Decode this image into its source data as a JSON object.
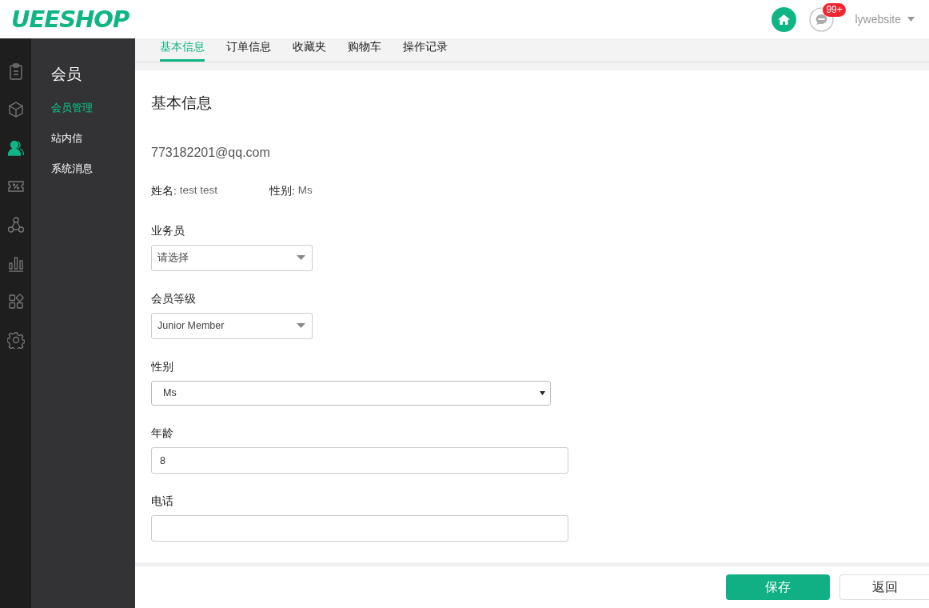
{
  "header": {
    "logo": "UEESHOP",
    "badge": "99+",
    "user": "lywebsite"
  },
  "rail": [
    {
      "kind": "clipboard",
      "selected": false
    },
    {
      "kind": "box",
      "selected": false
    },
    {
      "kind": "user",
      "selected": true
    },
    {
      "kind": "coupon",
      "selected": false
    },
    {
      "kind": "network",
      "selected": false
    },
    {
      "kind": "chart",
      "selected": false
    },
    {
      "kind": "apps",
      "selected": false
    },
    {
      "kind": "gear",
      "selected": false
    }
  ],
  "submenu": {
    "title": "会员",
    "items": [
      {
        "label": "会员管理",
        "selected": true
      },
      {
        "label": "站内信",
        "selected": false
      },
      {
        "label": "系统消息",
        "selected": false
      }
    ]
  },
  "tabs": [
    {
      "label": "基本信息",
      "selected": true
    },
    {
      "label": "订单信息",
      "selected": false
    },
    {
      "label": "收藏夹",
      "selected": false
    },
    {
      "label": "购物车",
      "selected": false
    },
    {
      "label": "操作记录",
      "selected": false
    }
  ],
  "form": {
    "heading": "基本信息",
    "email": "773182201@qq.com",
    "info": [
      {
        "label": "姓名:",
        "value": "test test"
      },
      {
        "label": "性别:",
        "value": "Ms"
      }
    ],
    "fields": [
      {
        "kind": "select",
        "label": "业务员",
        "value": "请选择"
      },
      {
        "kind": "select",
        "label": "会员等级",
        "value": "Junior Member"
      },
      {
        "kind": "native-select",
        "label": "性别",
        "value": "Ms"
      },
      {
        "kind": "input",
        "label": "年龄",
        "value": "8"
      },
      {
        "kind": "input",
        "label": "电话"
      }
    ]
  },
  "footer": {
    "save": "保存",
    "back": "返回"
  }
}
